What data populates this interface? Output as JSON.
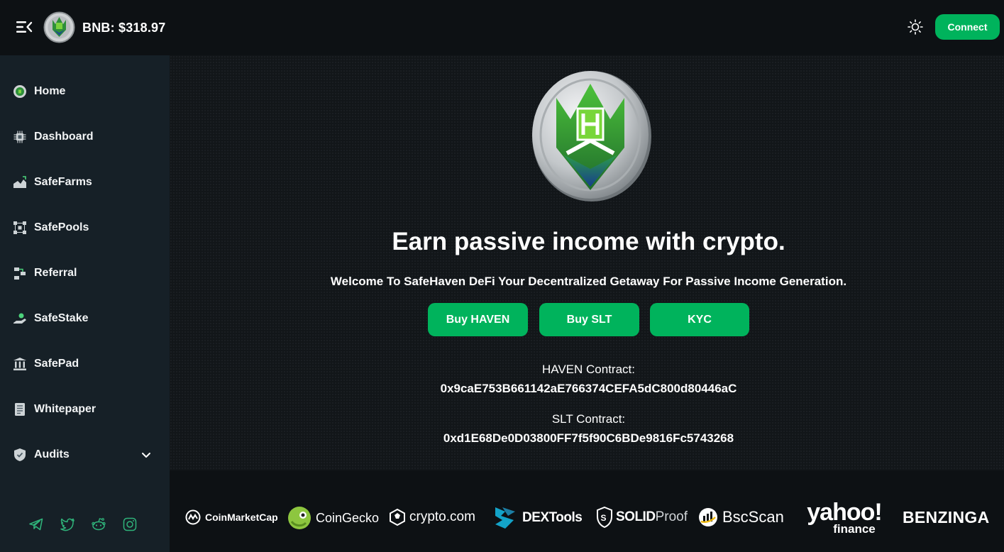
{
  "header": {
    "bnb_price": "BNB: $318.97",
    "connect_label": "Connect"
  },
  "sidebar": {
    "items": [
      {
        "label": "Home",
        "icon": "haven-coin-icon"
      },
      {
        "label": "Dashboard",
        "icon": "chip-icon"
      },
      {
        "label": "SafeFarms",
        "icon": "farm-icon"
      },
      {
        "label": "SafePools",
        "icon": "pool-icon"
      },
      {
        "label": "Referral",
        "icon": "referral-icon"
      },
      {
        "label": "SafeStake",
        "icon": "stake-icon"
      },
      {
        "label": "SafePad",
        "icon": "bank-icon"
      },
      {
        "label": "Whitepaper",
        "icon": "document-icon"
      },
      {
        "label": "Audits",
        "icon": "shield-icon"
      }
    ],
    "socials": [
      "telegram-icon",
      "twitter-icon",
      "reddit-icon",
      "instagram-icon"
    ],
    "social_color": "#2fb37a"
  },
  "hero": {
    "title": "Earn passive income with crypto.",
    "subtitle": "Welcome To SafeHaven DeFi Your Decentralized Getaway For Passive Income Generation.",
    "buttons": [
      "Buy HAVEN",
      "Buy SLT",
      "KYC"
    ],
    "haven_contract_label": "HAVEN Contract:",
    "haven_contract": "0x9caE753B661142aE766374CEFA5dC800d80446aC",
    "slt_contract_label": "SLT Contract:",
    "slt_contract": "0xd1E68De0D03800FF7f5f90C6BDe9816Fc5743268"
  },
  "partners": {
    "coinmarketcap": "CoinMarketCap",
    "coingecko": "CoinGecko",
    "cryptocom": "crypto.com",
    "dextools": "DEXTools",
    "solidproof_a": "SOLID",
    "solidproof_b": "Proof",
    "bscscan": "BscScan",
    "yahoo_a": "yahoo!",
    "yahoo_b": "finance",
    "benzinga": "BENZINGA"
  },
  "colors": {
    "accent": "#00b35c",
    "sidebar_bg": "#162027",
    "topbar_bg": "#0d1114",
    "main_bg": "#121619"
  }
}
